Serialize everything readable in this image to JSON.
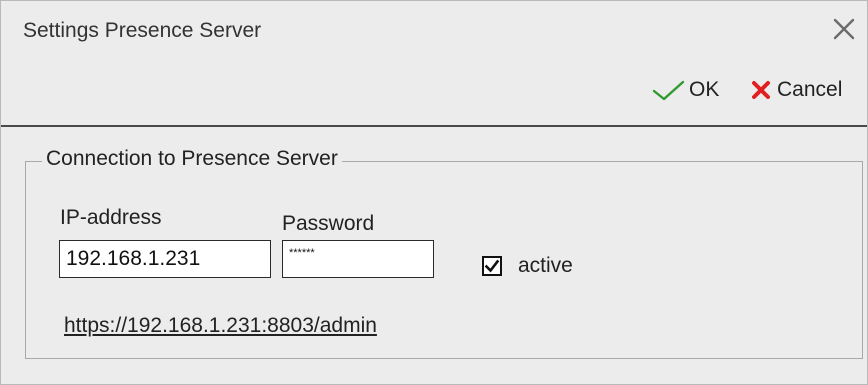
{
  "window": {
    "title": "Settings Presence Server"
  },
  "toolbar": {
    "ok_label": "OK",
    "cancel_label": "Cancel"
  },
  "connection": {
    "group_title": "Connection to Presence Server",
    "ip_label": "IP-address",
    "ip_value": "192.168.1.231",
    "password_label": "Password",
    "password_value": "******",
    "active_label": "active",
    "active_checked": true,
    "admin_url": "https://192.168.1.231:8803/admin"
  },
  "colors": {
    "ok_icon": "#2f9a2f",
    "cancel_icon": "#e02020",
    "window_bg": "#ececec"
  },
  "icons": {
    "ok": "checkmark-icon",
    "cancel": "x-icon",
    "close": "close-icon"
  }
}
